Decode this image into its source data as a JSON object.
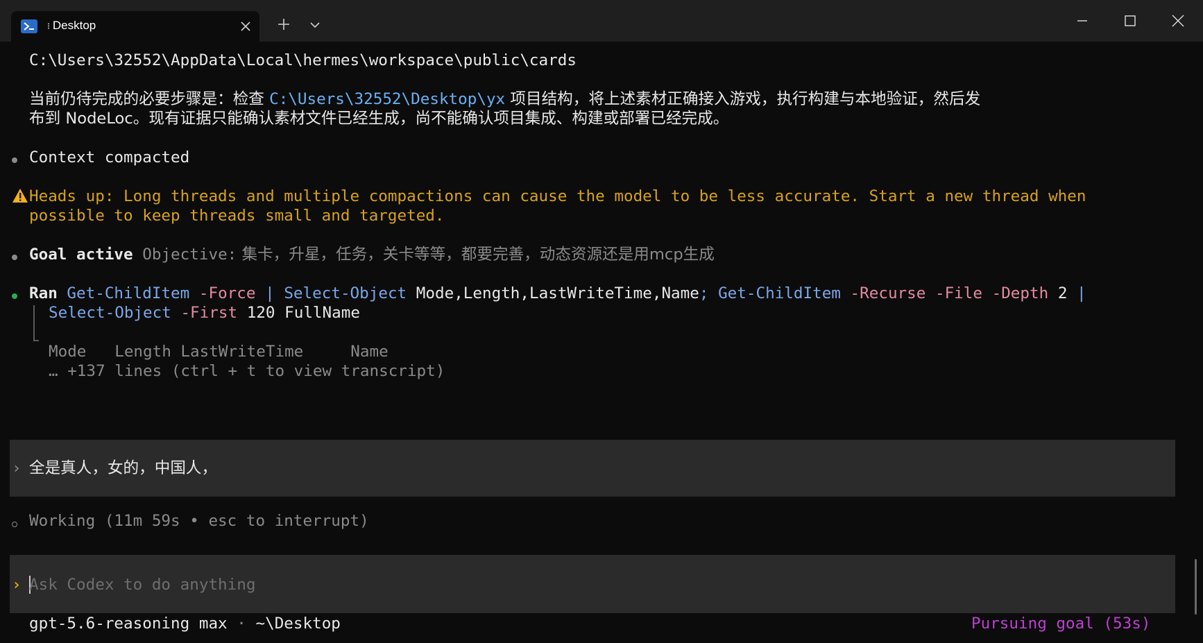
{
  "tab": {
    "title": "Desktop",
    "shell_icon": "powershell-icon"
  },
  "terminal": {
    "path_line": "C:\\Users\\32552\\AppData\\Local\\hermes\\workspace\\public\\cards",
    "steps": {
      "prefix": "当前仍待完成的必要步骤是：检查 ",
      "path": "C:\\Users\\32552\\Desktop\\yx",
      "suffix": " 项目结构，将上述素材正确接入游戏，执行构建与本地验证，然后发",
      "line2": "布到 NodeLoc。现有证据只能确认素材文件已经生成，尚不能确认项目集成、构建或部署已经完成。"
    },
    "context_compacted": "Context compacted",
    "warning": {
      "icon": "warning-icon",
      "line1": "Heads up: Long threads and multiple compactions can cause the model to be less accurate. Start a new thread when",
      "line2": "possible to keep threads small and targeted."
    },
    "goal": {
      "label": "Goal active",
      "objective_label": "Objective:",
      "objective_text": " 集卡，升星，任务，关卡等等，都要完善，动态资源还是用mcp生成"
    },
    "ran": {
      "label": "Ran",
      "cmd1": "Get-ChildItem",
      "flag_force": "-Force",
      "pipe": "|",
      "cmd2": "Select-Object",
      "args1": "Mode,Length,LastWriteTime,Name",
      "semi": ";",
      "cmd3": "Get-ChildItem",
      "flag_recurse": "-Recurse",
      "flag_file": "-File",
      "flag_depth": "-Depth",
      "depth_value": "2",
      "pipe2": "|",
      "cmd4": "Select-Object",
      "flag_first": "-First",
      "first_value": "120",
      "args2": "FullName",
      "output_header": "Mode   Length LastWriteTime     Name",
      "more_lines": "… +137 lines (ctrl + t to view transcript)"
    },
    "user_message": "全是真人，女的，中国人，",
    "working": "Working (11m 59s • esc to interrupt)",
    "input_placeholder": "Ask Codex to do anything",
    "status": {
      "model": "gpt-5.6-reasoning max",
      "sep": "·",
      "cwd": "~\\Desktop",
      "goal_status": "Pursuing goal (53s)"
    }
  },
  "colors": {
    "background": "#0c0c0c",
    "titlebar": "#1f1f1f",
    "warning": "#d8a21b",
    "success": "#23b14d",
    "goal_status": "#bd3fd1",
    "command": "#7aa7e8",
    "flag": "#e58aa0"
  }
}
